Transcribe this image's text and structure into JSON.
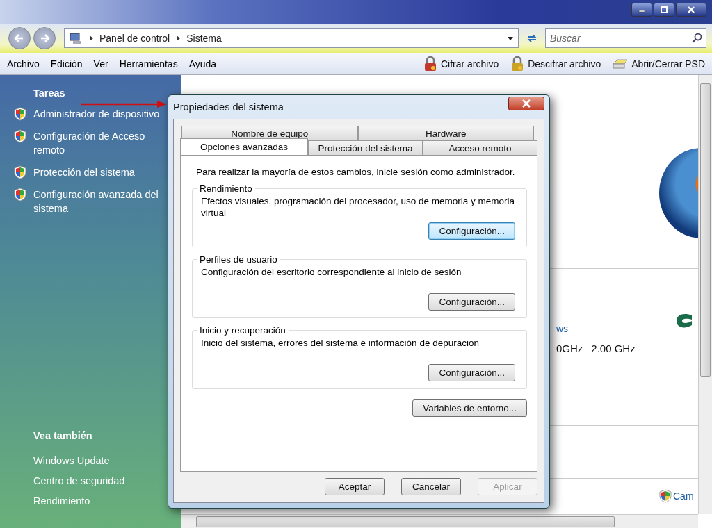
{
  "address": {
    "crumbs": [
      "Panel de control",
      "Sistema"
    ]
  },
  "search": {
    "placeholder": "Buscar"
  },
  "menu": [
    "Archivo",
    "Edición",
    "Ver",
    "Herramientas",
    "Ayuda"
  ],
  "toolbar": [
    {
      "kind": "lock-red",
      "label": "Cifrar archivo"
    },
    {
      "kind": "lock-gold",
      "label": "Descifrar archivo"
    },
    {
      "kind": "drive",
      "label": "Abrir/Cerrar PSD"
    }
  ],
  "sidebar": {
    "tasks_title": "Tareas",
    "tasks": [
      "Administrador de dispositivo",
      "Configuración de Acceso remoto",
      "Protección del sistema",
      "Configuración avanzada del sistema"
    ],
    "see_also_title": "Vea también",
    "see_also": [
      "Windows Update",
      "Centro de seguridad",
      "Rendimiento"
    ]
  },
  "content": {
    "link_fragment": "ws",
    "cpu": [
      "0GHz",
      "2.00 GHz"
    ],
    "change_link": "Cam"
  },
  "dialog": {
    "title": "Propiedades del sistema",
    "tab_rows": [
      [
        {
          "label": "Nombre de equipo",
          "selected": false
        },
        {
          "label": "Hardware",
          "selected": false
        }
      ],
      [
        {
          "label": "Opciones avanzadas",
          "selected": true
        },
        {
          "label": "Protección del sistema",
          "selected": false
        },
        {
          "label": "Acceso remoto",
          "selected": false
        }
      ]
    ],
    "notice": "Para realizar la mayoría de estos cambios, inicie sesión como administrador.",
    "groups": [
      {
        "title": "Rendimiento",
        "description": "Efectos visuales, programación del procesador, uso de memoria y memoria virtual",
        "button": "Configuración...",
        "focused": true
      },
      {
        "title": "Perfiles de usuario",
        "description": "Configuración del escritorio correspondiente al inicio de sesión",
        "button": "Configuración...",
        "focused": false
      },
      {
        "title": "Inicio y recuperación",
        "description": "Inicio del sistema, errores del sistema e información de depuración",
        "button": "Configuración...",
        "focused": false
      }
    ],
    "env_button": "Variables de entorno...",
    "buttons": [
      {
        "label": "Aceptar",
        "disabled": false
      },
      {
        "label": "Cancelar",
        "disabled": false
      },
      {
        "label": "Aplicar",
        "disabled": true
      }
    ]
  }
}
